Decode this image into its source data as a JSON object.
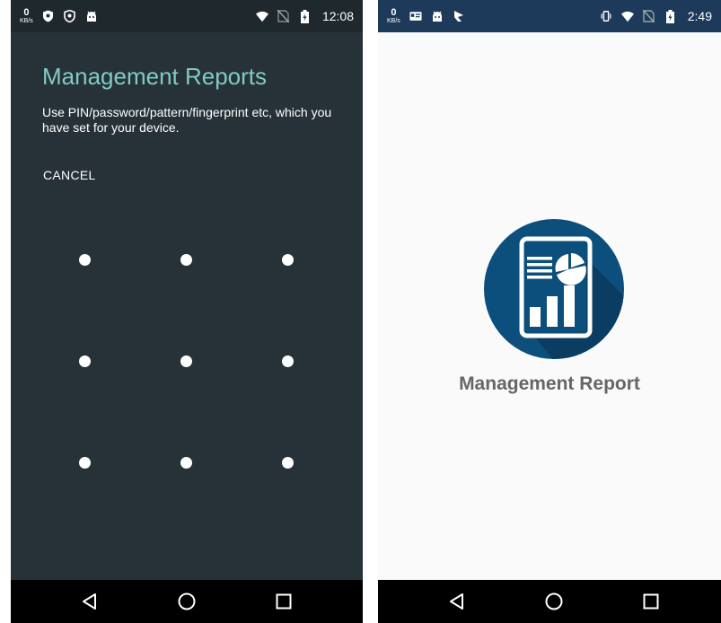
{
  "left_screen": {
    "status_bar": {
      "speed_value": "0",
      "speed_unit": "KB/s",
      "time": "12:08",
      "icons": [
        "shield-icon",
        "vpn-icon",
        "android-icon",
        "wifi-icon",
        "no-sim-icon",
        "battery-charging-icon"
      ]
    },
    "title": "Management Reports",
    "subtitle": "Use PIN/password/pattern/fingerprint etc, which you have set for your device.",
    "cancel_label": "CANCEL",
    "pattern_grid": {
      "rows": 3,
      "cols": 3
    },
    "colors": {
      "background": "#263238",
      "title": "#80cbc4"
    }
  },
  "right_screen": {
    "status_bar": {
      "speed_value": "0",
      "speed_unit": "KB/s",
      "time": "2:49",
      "icons": [
        "id-card-icon",
        "android-icon",
        "flag-icon",
        "vibrate-icon",
        "wifi-icon",
        "no-sim-icon",
        "battery-charging-icon"
      ]
    },
    "app_name": "Management Report",
    "logo": "report-chart-icon",
    "colors": {
      "status_bar": "#1d3a5a",
      "logo_circle": "#0d4f7c",
      "app_name": "#666666"
    }
  },
  "navbar": {
    "icons": [
      "back-icon",
      "home-icon",
      "recents-icon"
    ]
  }
}
